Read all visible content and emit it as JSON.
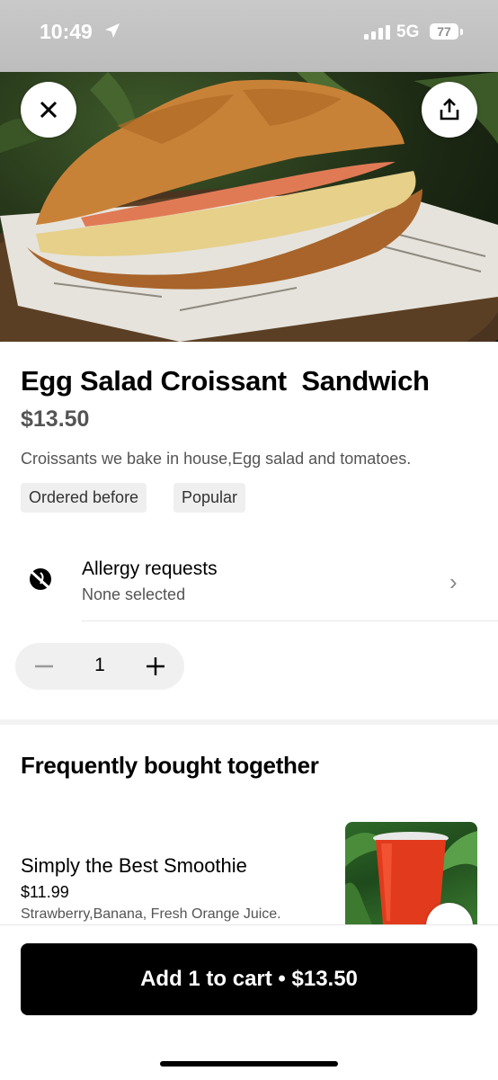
{
  "status_bar": {
    "time": "10:49",
    "network": "5G",
    "battery": "77"
  },
  "product": {
    "title": "Egg Salad Croissant  Sandwich",
    "price": "$13.50",
    "description": "Croissants we bake in house,Egg salad and tomatoes.",
    "tags": [
      "Ordered before",
      "Popular"
    ],
    "image_icon": "croissant-sandwich-photo"
  },
  "allergy": {
    "title": "Allergy requests",
    "subtitle": "None selected",
    "chevron": "›"
  },
  "quantity": {
    "value": "1"
  },
  "frequently_bought": {
    "title": "Frequently bought together",
    "items": [
      {
        "name": "Simply the Best Smoothie",
        "price": "$11.99",
        "description": "Strawberry,Banana, Fresh Orange Juice."
      }
    ]
  },
  "cart": {
    "label": "Add 1 to cart • $13.50"
  },
  "colors": {
    "primary": "#000000",
    "secondary_text": "#545454",
    "tag_bg": "#efefef"
  }
}
